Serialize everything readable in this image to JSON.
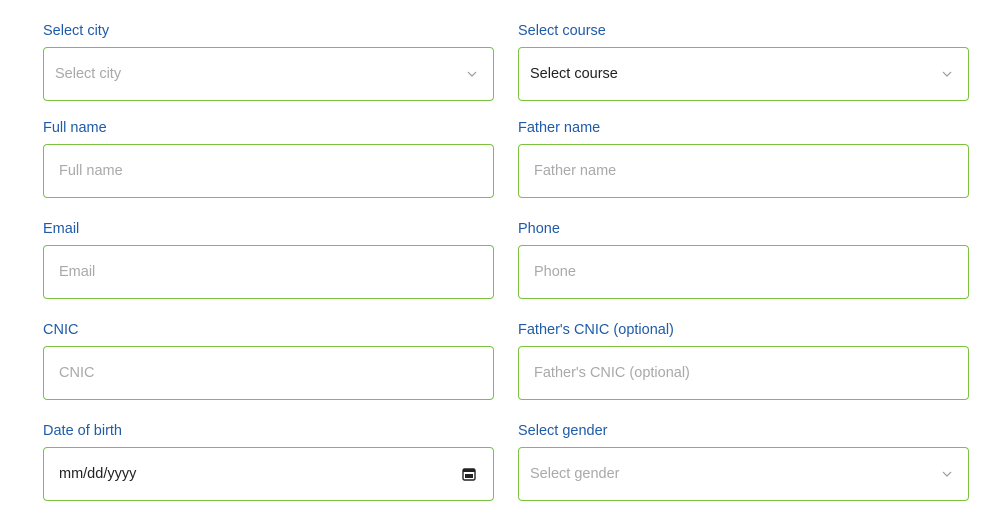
{
  "form": {
    "city": {
      "label": "Select city",
      "placeholder": "Select city",
      "value": ""
    },
    "course": {
      "label": "Select course",
      "placeholder": "Select course",
      "value": "Select course"
    },
    "full_name": {
      "label": "Full name",
      "placeholder": "Full name"
    },
    "father_name": {
      "label": "Father name",
      "placeholder": "Father name"
    },
    "email": {
      "label": "Email",
      "placeholder": "Email"
    },
    "phone": {
      "label": "Phone",
      "placeholder": "Phone"
    },
    "cnic": {
      "label": "CNIC",
      "placeholder": "CNIC"
    },
    "father_cnic": {
      "label": "Father's CNIC (optional)",
      "placeholder": "Father's CNIC (optional)"
    },
    "dob": {
      "label": "Date of birth",
      "value": "mm/dd/yyyy"
    },
    "gender": {
      "label": "Select gender",
      "placeholder": "Select gender"
    }
  },
  "icons": {
    "dropdown": "chevron-down-icon",
    "date": "calendar-icon"
  },
  "colors": {
    "label": "#1f5ba8",
    "border": "#7dc142",
    "placeholder": "#a9a9a9",
    "value_text": "#222222"
  }
}
